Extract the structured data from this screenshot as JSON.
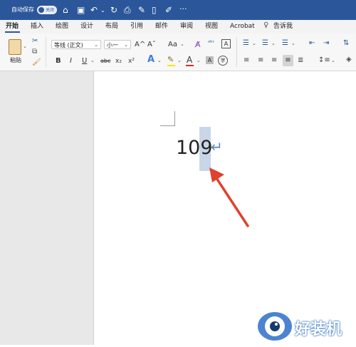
{
  "titlebar": {
    "autosave_label": "自动保存",
    "toggle_label": "关闭",
    "more": "···"
  },
  "tabs": [
    {
      "label": "开始"
    },
    {
      "label": "插入"
    },
    {
      "label": "绘图"
    },
    {
      "label": "设计"
    },
    {
      "label": "布局"
    },
    {
      "label": "引用"
    },
    {
      "label": "邮件"
    },
    {
      "label": "审阅"
    },
    {
      "label": "视图"
    },
    {
      "label": "Acrobat"
    },
    {
      "label": "告诉我"
    }
  ],
  "ribbon": {
    "paste_label": "粘贴",
    "font_name": "等线 (正文)",
    "font_size": "小一",
    "grow_font": "A^",
    "shrink_font": "Aˇ",
    "change_case": "Aa",
    "bold": "B",
    "italic": "I",
    "underline": "U",
    "strikethrough": "abc",
    "subscript": "x₂",
    "superscript": "x²",
    "text_effects": "A",
    "highlight": "✎",
    "font_color": "A",
    "char_shading": "A",
    "enclose": "字"
  },
  "document": {
    "text": "109",
    "paragraph_mark": "↵"
  },
  "watermark": {
    "text": "好装机"
  },
  "colors": {
    "titlebar": "#2b579a",
    "selection": "#c9d6e8",
    "arrow": "#e0412c",
    "font_color_bar": "#e02b20",
    "highlight_bar": "#f5e600"
  }
}
